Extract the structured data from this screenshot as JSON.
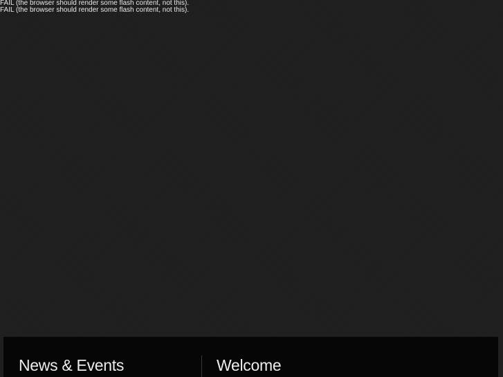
{
  "fallback_messages": [
    "FAIL (the browser should render some flash content, not this).",
    "FAIL (the browser should render some flash content, not this)."
  ],
  "footer": {
    "news_heading": "News & Events",
    "welcome_heading": "Welcome"
  }
}
